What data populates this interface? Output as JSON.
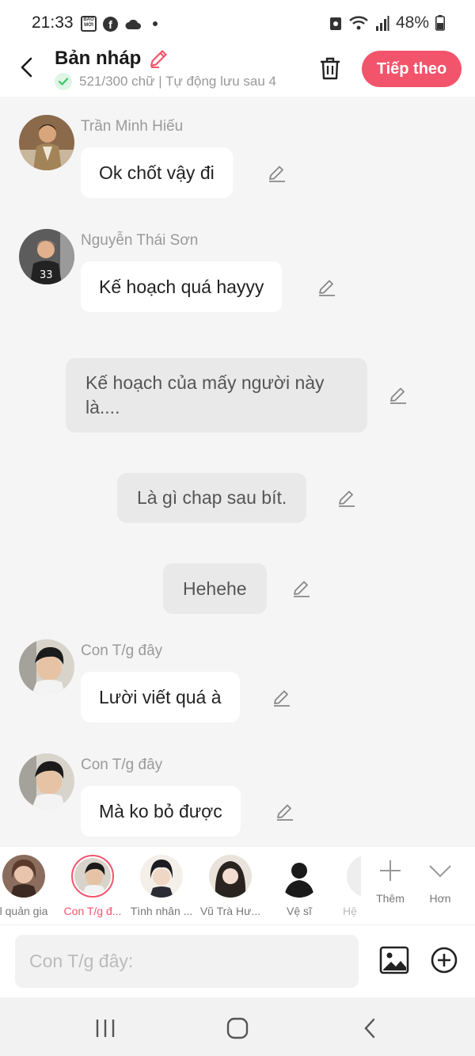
{
  "status_bar": {
    "time": "21:33",
    "battery": "48%",
    "box_icon_text": "BÁO MỚI"
  },
  "header": {
    "title": "Bản nháp",
    "subtitle": "521/300 chữ | Tự động lưu sau 4",
    "next_button": "Tiếp theo"
  },
  "messages": [
    {
      "type": "character",
      "sender": "Trần Minh Hiếu",
      "text": "Ok chốt vậy đi"
    },
    {
      "type": "character",
      "sender": "Nguyễn Thái Sơn",
      "text": "Kế hoạch quá hayyy"
    },
    {
      "type": "narration",
      "text_line1": "Kế hoạch của mấy người này",
      "text_line2": "là...."
    },
    {
      "type": "narration",
      "text": "Là gì chap sau bít."
    },
    {
      "type": "narration",
      "text": "Hehehe"
    },
    {
      "type": "character",
      "sender": "Con T/g đây",
      "text": "Lười viết quá à"
    },
    {
      "type": "character",
      "sender": "Con T/g đây",
      "text": "Mà ko bỏ được"
    }
  ],
  "characters": [
    {
      "name": "Quản gia",
      "display": "l quản gia"
    },
    {
      "name": "Con T/g đ...",
      "selected": true
    },
    {
      "name": "Tình nhân ..."
    },
    {
      "name": "Vũ Trà Hư..."
    },
    {
      "name": "Vệ sĩ"
    },
    {
      "name": "Hệ"
    }
  ],
  "strip_actions": {
    "add": "Thêm",
    "more": "Hơn"
  },
  "input": {
    "placeholder": "Con T/g đây:"
  },
  "colors": {
    "accent": "#f2546b",
    "chat_bg": "#f5f5f5",
    "narration_bg": "#e9e9e9",
    "success": "#3cc46a"
  },
  "icons": [
    "back-icon",
    "pencil-icon",
    "check-icon",
    "trash-icon",
    "plus-icon",
    "chevron-down-icon",
    "image-icon",
    "add-circle-icon",
    "recents-icon",
    "home-icon",
    "nav-back-icon"
  ]
}
